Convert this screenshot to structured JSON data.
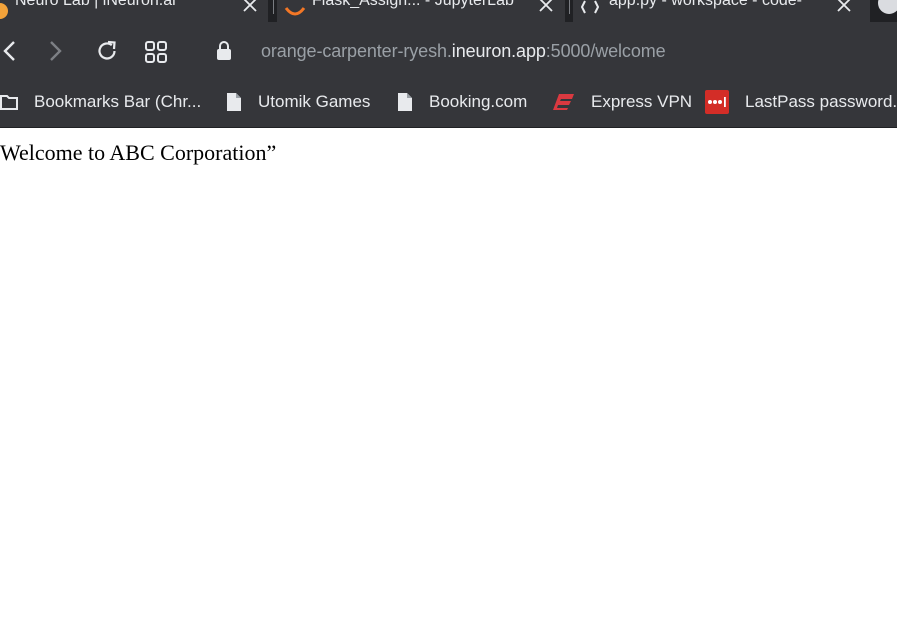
{
  "tabs": [
    {
      "title": "Neuro Lab | iNeuron.ai"
    },
    {
      "title": "Flask_Assign... - JupyterLab"
    },
    {
      "title": "app.py - workspace - code-"
    }
  ],
  "address_bar": {
    "url_prefix": "orange-carpenter-ryesh.",
    "url_host": "ineuron.app",
    "url_suffix": ":5000/welcome"
  },
  "bookmarks": [
    {
      "label": "Bookmarks Bar (Chr...",
      "icon": "folder-icon"
    },
    {
      "label": "Utomik Games",
      "icon": "page-icon"
    },
    {
      "label": "Booking.com",
      "icon": "page-icon"
    },
    {
      "label": "Express VPN",
      "icon": "expressvpn-icon"
    },
    {
      "label": "LastPass password...",
      "icon": "lastpass-icon"
    }
  ],
  "page": {
    "heading": "Welcome to ABC Corporation”"
  },
  "colors": {
    "tab_strip": "#202124",
    "toolbar": "#35363a",
    "text_light": "#e8eaed",
    "text_dim": "#9aa0a6",
    "jupyter_orange": "#f37726",
    "expressvpn_red": "#da3940",
    "lastpass_red": "#d32d27"
  }
}
